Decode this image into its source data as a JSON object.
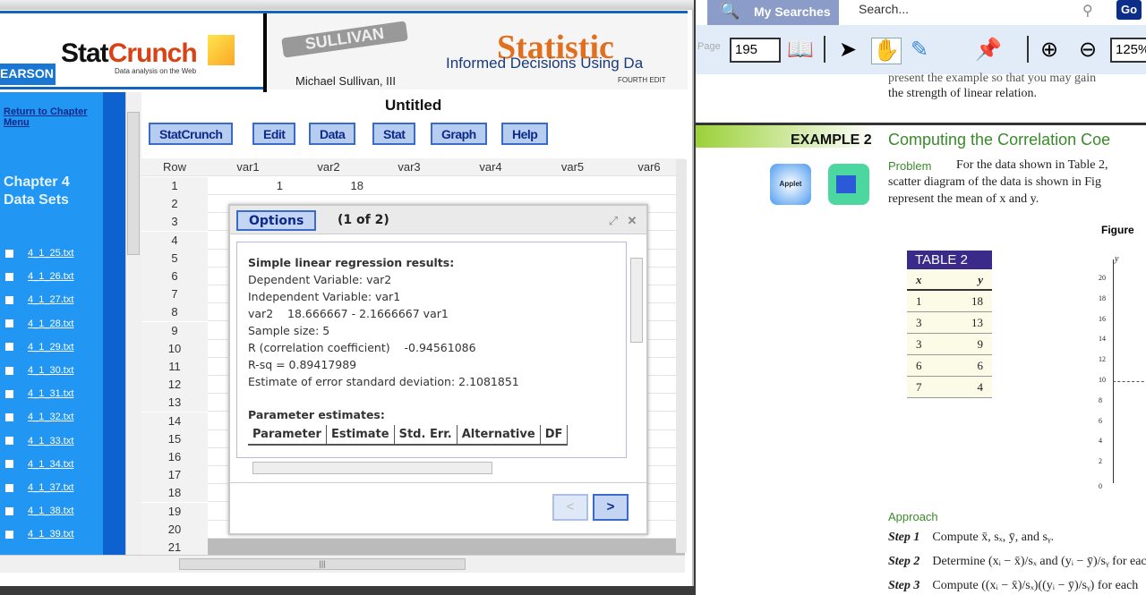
{
  "statcrunch": {
    "brand": "EARSON",
    "logo_stat": "Stat",
    "logo_crunch": "Crunch",
    "logo_tagline": "Data analysis on the Web",
    "book_seal": "SULLIVAN",
    "book_author": "Michael Sullivan, III",
    "book_title": "Statistic",
    "book_subtitle": "Informed Decisions Using Da",
    "book_edition": "FOURTH EDIT",
    "sidebar": {
      "return_link": "Return to Chapter Menu",
      "chapter_title": "Chapter 4 Data Sets",
      "files": [
        "4_1_25.txt",
        "4_1_26.txt",
        "4_1_27.txt",
        "4_1_28.txt",
        "4_1_29.txt",
        "4_1_30.txt",
        "4_1_31.txt",
        "4_1_32.txt",
        "4_1_33.txt",
        "4_1_34.txt",
        "4_1_37.txt",
        "4_1_38.txt",
        "4_1_39.txt"
      ]
    },
    "sheet_title": "Untitled",
    "menu": [
      "StatCrunch",
      "Edit",
      "Data",
      "Stat",
      "Graph",
      "Help"
    ],
    "grid": {
      "columns": [
        "Row",
        "var1",
        "var2",
        "var3",
        "var4",
        "var5",
        "var6"
      ],
      "rows": [
        "1",
        "2",
        "3",
        "4",
        "5",
        "6",
        "7",
        "8",
        "9",
        "10",
        "11",
        "12",
        "13",
        "14",
        "15",
        "16",
        "17",
        "18",
        "19",
        "20",
        "21"
      ],
      "cells": [
        [
          "1",
          "18"
        ]
      ]
    },
    "dialog": {
      "options_label": "Options",
      "page": "(1 of 2)",
      "heading": "Simple linear regression results:",
      "lines": [
        "Dependent Variable: var2",
        "Independent Variable: var1",
        "var2    18.666667 - 2.1666667 var1",
        "Sample size: 5",
        "R (correlation coefficient)    -0.94561086",
        "R-sq = 0.89417989",
        "Estimate of error standard deviation: 2.1081851"
      ],
      "param_heading": "Parameter estimates:",
      "param_columns": [
        "Parameter",
        "Estimate",
        "Std. Err.",
        "Alternative",
        "DF"
      ],
      "prev": "<",
      "next": ">"
    }
  },
  "reader": {
    "my_searches": "My Searches",
    "search_placeholder": "Search...",
    "go": "Go",
    "page_label": "Page",
    "page": "195",
    "zoom": "125%",
    "text_top1": "present the example so that you may gain",
    "text_top2": "the strength of linear relation.",
    "example_label": "EXAMPLE 2",
    "example_title": "Computing the Correlation Coe",
    "applet": "Applet",
    "problem_label": "Problem",
    "problem_lines": [
      "For the data shown in Table 2,",
      "scatter diagram of the data is shown in Fig",
      "represent the mean of x and y."
    ],
    "figure_label": "Figure",
    "table_title": "TABLE 2",
    "table_cols": [
      "x",
      "y"
    ],
    "table_rows": [
      [
        "1",
        "18"
      ],
      [
        "3",
        "13"
      ],
      [
        "3",
        "9"
      ],
      [
        "6",
        "6"
      ],
      [
        "7",
        "4"
      ]
    ],
    "y_ticks": [
      "20",
      "18",
      "16",
      "14",
      "12",
      "10",
      "8",
      "6",
      "4",
      "2",
      "0"
    ],
    "y_axis": "y",
    "approach": "Approach",
    "steps": [
      {
        "label": "Step 1",
        "text": "Compute x̄, sₓ, ȳ, and sᵧ."
      },
      {
        "label": "Step 2",
        "text": "Determine (xᵢ − x̄)/sₓ and (yᵢ − ȳ)/sᵧ for eac"
      },
      {
        "label": "Step 3",
        "text": "Compute ((xᵢ − x̄)/sₓ)((yᵢ − ȳ)/sᵧ) for each"
      }
    ]
  }
}
